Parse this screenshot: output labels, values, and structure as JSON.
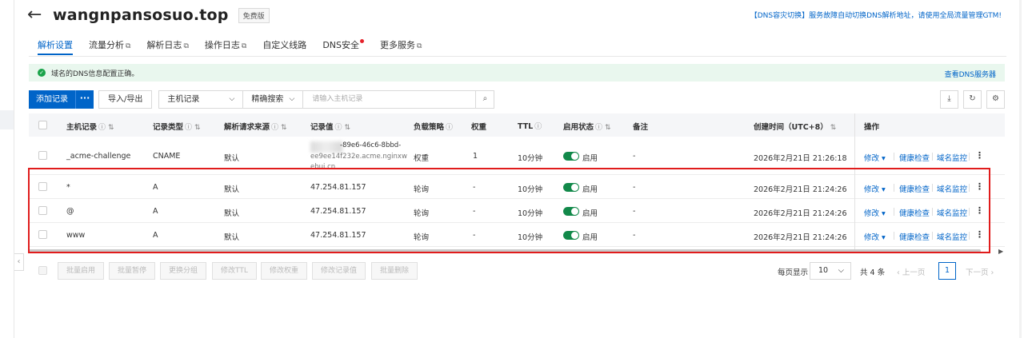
{
  "header": {
    "domain": "wangnpansosuo.top",
    "plan_badge": "免费版",
    "top_link": "【DNS容灾切换】服务故障自动切换DNS解析地址，请使用全局流量管理GTM!"
  },
  "tabs": [
    {
      "label": "解析设置",
      "active": true
    },
    {
      "label": "流量分析",
      "external": true
    },
    {
      "label": "解析日志",
      "external": true
    },
    {
      "label": "操作日志",
      "external": true
    },
    {
      "label": "自定义线路"
    },
    {
      "label": "DNS安全",
      "badge": "red-dot"
    },
    {
      "label": "更多服务",
      "external": true
    }
  ],
  "alert": {
    "text": "域名的DNS信息配置正确。",
    "link": "查看DNS服务器",
    "color": "#1aa34a"
  },
  "toolbar": {
    "add_label": "添加记录",
    "more_label": "···",
    "import_export_label": "导入/导出",
    "field_select": "主机记录",
    "search_mode": "精确搜索",
    "search_placeholder": "请输入主机记录"
  },
  "table": {
    "headers": {
      "host": "主机记录",
      "type": "记录类型",
      "source": "解析请求来源",
      "value": "记录值",
      "lb": "负载策略",
      "weight": "权重",
      "ttl": "TTL",
      "status": "启用状态",
      "remark": "备注",
      "created": "创建时间（UTC+8）",
      "ops": "操作"
    },
    "rows": [
      {
        "host": "_acme-challenge",
        "type": "CNAME",
        "source": "默认",
        "value_l1": "-89e6-46c6-8bbd-",
        "value_l2": "ee9ee14f232e.acme.nginxw",
        "value_l3": "ebui.cn",
        "lb": "权重",
        "weight": "1",
        "ttl": "10分钟",
        "status": "启用",
        "remark": "-",
        "created": "2026年2月21日 21:26:18"
      },
      {
        "host": "*",
        "type": "A",
        "source": "默认",
        "value": "47.254.81.157",
        "lb": "轮询",
        "weight": "-",
        "ttl": "10分钟",
        "status": "启用",
        "remark": "-",
        "created": "2026年2月21日 21:24:26"
      },
      {
        "host": "@",
        "type": "A",
        "source": "默认",
        "value": "47.254.81.157",
        "lb": "轮询",
        "weight": "-",
        "ttl": "10分钟",
        "status": "启用",
        "remark": "-",
        "created": "2026年2月21日 21:24:26"
      },
      {
        "host": "www",
        "type": "A",
        "source": "默认",
        "value": "47.254.81.157",
        "lb": "轮询",
        "weight": "-",
        "ttl": "10分钟",
        "status": "启用",
        "remark": "-",
        "created": "2026年2月21日 21:24:26"
      }
    ],
    "row_ops": {
      "edit": "修改",
      "health": "健康检查",
      "monitor": "域名监控"
    }
  },
  "footer": {
    "bulk_buttons": [
      "批量启用",
      "批量暂停",
      "更换分组",
      "修改TTL",
      "修改权重",
      "修改记录值",
      "批量删除"
    ],
    "page_size_label": "每页显示",
    "page_size": "10",
    "total": "共 4 条",
    "prev": "上一页",
    "current_page": "1",
    "next": "下一页"
  }
}
